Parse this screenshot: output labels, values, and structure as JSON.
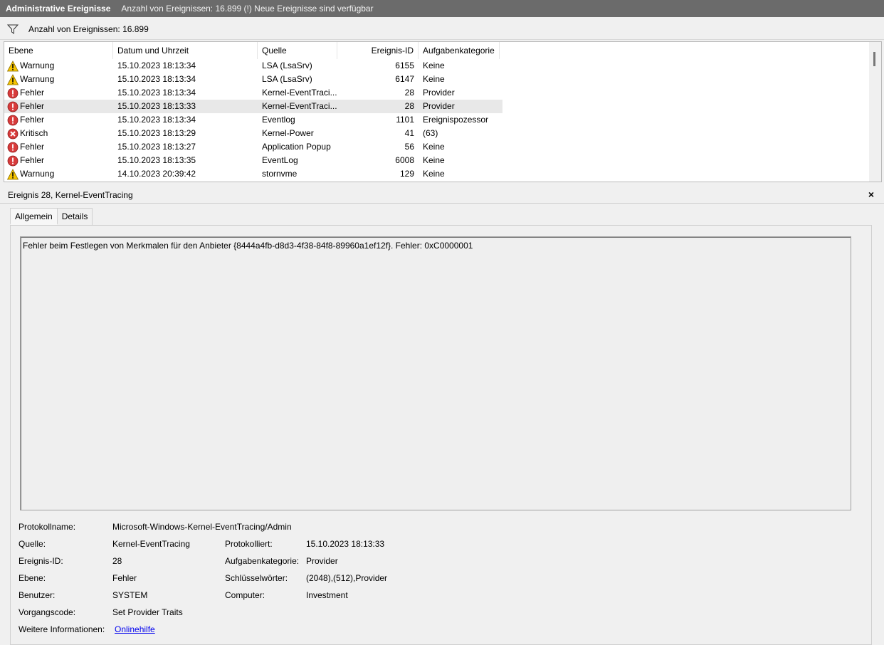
{
  "title": {
    "name": "Administrative Ereignisse",
    "info": "Anzahl von Ereignissen: 16.899 (!) Neue Ereignisse sind verfügbar"
  },
  "filter": {
    "label": "Anzahl von Ereignissen: 16.899",
    "icon": "filter-icon"
  },
  "columns": [
    "Ebene",
    "Datum und Uhrzeit",
    "Quelle",
    "Ereignis-ID",
    "Aufgabenkategorie"
  ],
  "events": [
    {
      "level": "Warnung",
      "icon": "warning-icon",
      "date": "15.10.2023 18:13:34",
      "source": "LSA (LsaSrv)",
      "id": "6155",
      "category": "Keine"
    },
    {
      "level": "Warnung",
      "icon": "warning-icon",
      "date": "15.10.2023 18:13:34",
      "source": "LSA (LsaSrv)",
      "id": "6147",
      "category": "Keine"
    },
    {
      "level": "Fehler",
      "icon": "error-icon",
      "date": "15.10.2023 18:13:34",
      "source": "Kernel-EventTraci...",
      "id": "28",
      "category": "Provider"
    },
    {
      "level": "Fehler",
      "icon": "error-icon",
      "date": "15.10.2023 18:13:33",
      "source": "Kernel-EventTraci...",
      "id": "28",
      "category": "Provider"
    },
    {
      "level": "Fehler",
      "icon": "error-icon",
      "date": "15.10.2023 18:13:34",
      "source": "Eventlog",
      "id": "1101",
      "category": "Ereignispozessor"
    },
    {
      "level": "Kritisch",
      "icon": "critical-icon",
      "date": "15.10.2023 18:13:29",
      "source": "Kernel-Power",
      "id": "41",
      "category": "(63)"
    },
    {
      "level": "Fehler",
      "icon": "error-icon",
      "date": "15.10.2023 18:13:27",
      "source": "Application Popup",
      "id": "56",
      "category": "Keine"
    },
    {
      "level": "Fehler",
      "icon": "error-icon",
      "date": "15.10.2023 18:13:35",
      "source": "EventLog",
      "id": "6008",
      "category": "Keine"
    },
    {
      "level": "Warnung",
      "icon": "warning-icon",
      "date": "14.10.2023 20:39:42",
      "source": "stornvme",
      "id": "129",
      "category": "Keine"
    }
  ],
  "detail": {
    "header": "Ereignis 28, Kernel-EventTracing",
    "close": "×",
    "tabs": [
      "Allgemein",
      "Details"
    ],
    "message": "Fehler beim Festlegen von Merkmalen für den Anbieter {8444a4fb-d8d3-4f38-84f8-89960a1ef12f}. Fehler: 0xC0000001",
    "props": {
      "protokollname_label": "Protokollname:",
      "protokollname": "Microsoft-Windows-Kernel-EventTracing/Admin",
      "quelle_label": "Quelle:",
      "quelle": "Kernel-EventTracing",
      "protokolliert_label": "Protokolliert:",
      "protokolliert": "15.10.2023 18:13:33",
      "ereignisid_label": "Ereignis-ID:",
      "ereignisid": "28",
      "aufgabe_label": "Aufgabenkategorie:",
      "aufgabe": "Provider",
      "ebene_label": "Ebene:",
      "ebene": "Fehler",
      "schluessel_label": "Schlüsselwörter:",
      "schluessel": "(2048),(512),Provider",
      "benutzer_label": "Benutzer:",
      "benutzer": "SYSTEM",
      "computer_label": "Computer:",
      "computer": "Investment",
      "vorgang_label": "Vorgangscode:",
      "vorgang": "Set Provider Traits",
      "weitere_label": "Weitere Informationen:",
      "weitere": "Onlinehilfe"
    }
  }
}
